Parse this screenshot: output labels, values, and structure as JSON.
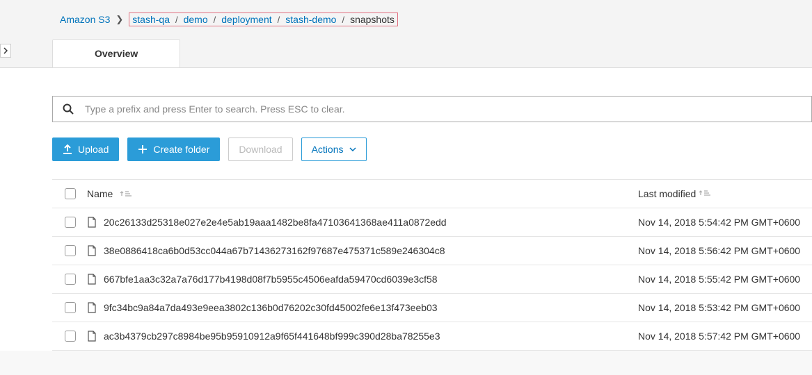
{
  "breadcrumb": {
    "root": "Amazon S3",
    "crumbs": [
      "stash-qa",
      "demo",
      "deployment",
      "stash-demo"
    ],
    "current": "snapshots"
  },
  "tabs": {
    "overview": "Overview"
  },
  "search": {
    "placeholder": "Type a prefix and press Enter to search. Press ESC to clear."
  },
  "toolbar": {
    "upload": "Upload",
    "create_folder": "Create folder",
    "download": "Download",
    "actions": "Actions"
  },
  "table": {
    "headers": {
      "name": "Name",
      "modified": "Last modified"
    },
    "rows": [
      {
        "name": "20c26133d25318e027e2e4e5ab19aaa1482be8fa47103641368ae411a0872edd",
        "modified": "Nov 14, 2018 5:54:42 PM GMT+0600"
      },
      {
        "name": "38e0886418ca6b0d53cc044a67b71436273162f97687e475371c589e246304c8",
        "modified": "Nov 14, 2018 5:56:42 PM GMT+0600"
      },
      {
        "name": "667bfe1aa3c32a7a76d177b4198d08f7b5955c4506eafda59470cd6039e3cf58",
        "modified": "Nov 14, 2018 5:55:42 PM GMT+0600"
      },
      {
        "name": "9fc34bc9a84a7da493e9eea3802c136b0d76202c30fd45002fe6e13f473eeb03",
        "modified": "Nov 14, 2018 5:53:42 PM GMT+0600"
      },
      {
        "name": "ac3b4379cb297c8984be95b95910912a9f65f441648bf999c390d28ba78255e3",
        "modified": "Nov 14, 2018 5:57:42 PM GMT+0600"
      }
    ]
  }
}
